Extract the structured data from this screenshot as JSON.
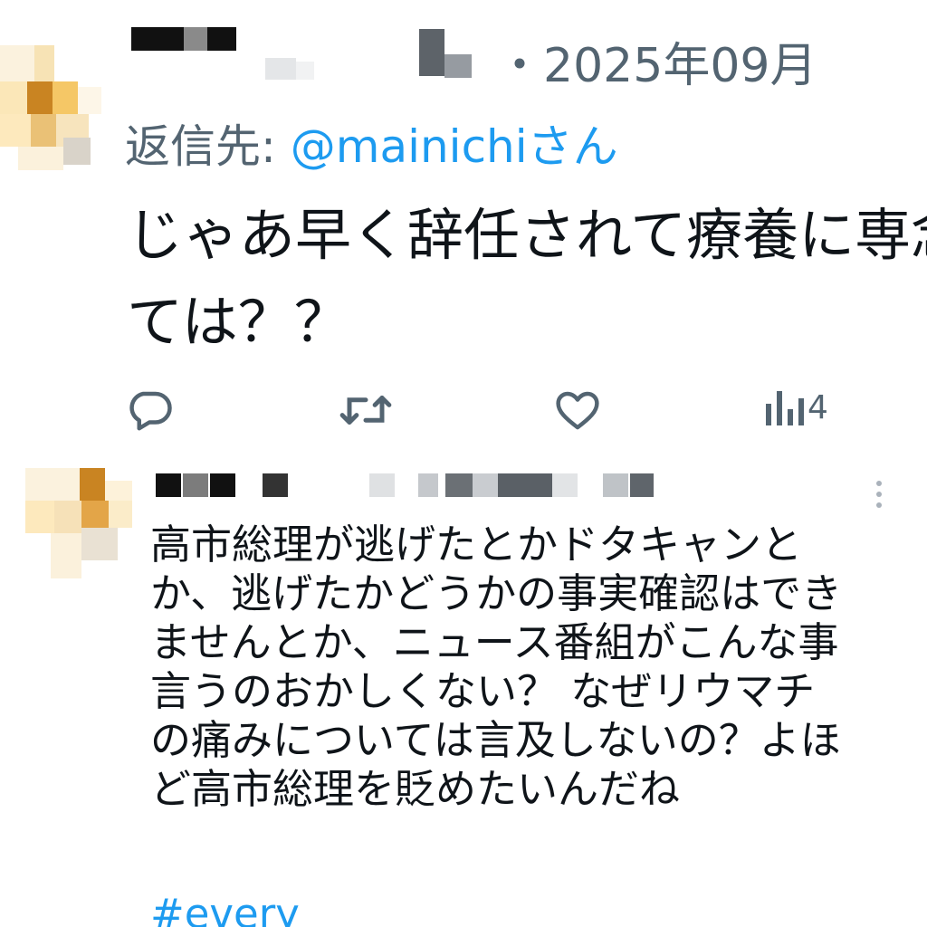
{
  "tweet1": {
    "date": "・2025年09月",
    "reply_prefix": "返信先: ",
    "reply_handle": "@mainichiさん",
    "body": "じゃあ早く辞任されて療養に専念し\nては？？",
    "actions": {
      "reply_icon": "reply-icon",
      "retweet_icon": "retweet-icon",
      "like_icon": "heart-icon",
      "views_icon": "views-icon",
      "views_count": "4"
    }
  },
  "tweet2": {
    "body_lines": [
      "高市総理が逃げたとかドタキャンと",
      "か、逃げたかどうかの事実確認はでき",
      "ませんとか、ニュース番組がこんな事",
      "言うのおかしくない？ なぜリウマチ",
      "の痛みについては言及しないの？よほ",
      "ど高市総理を貶めたいんだね"
    ],
    "hashtag": "#every",
    "more_icon": "more-vertical-icon"
  },
  "colors": {
    "text_primary": "#0f1419",
    "text_secondary": "#536471",
    "link": "#1d9bf0"
  }
}
